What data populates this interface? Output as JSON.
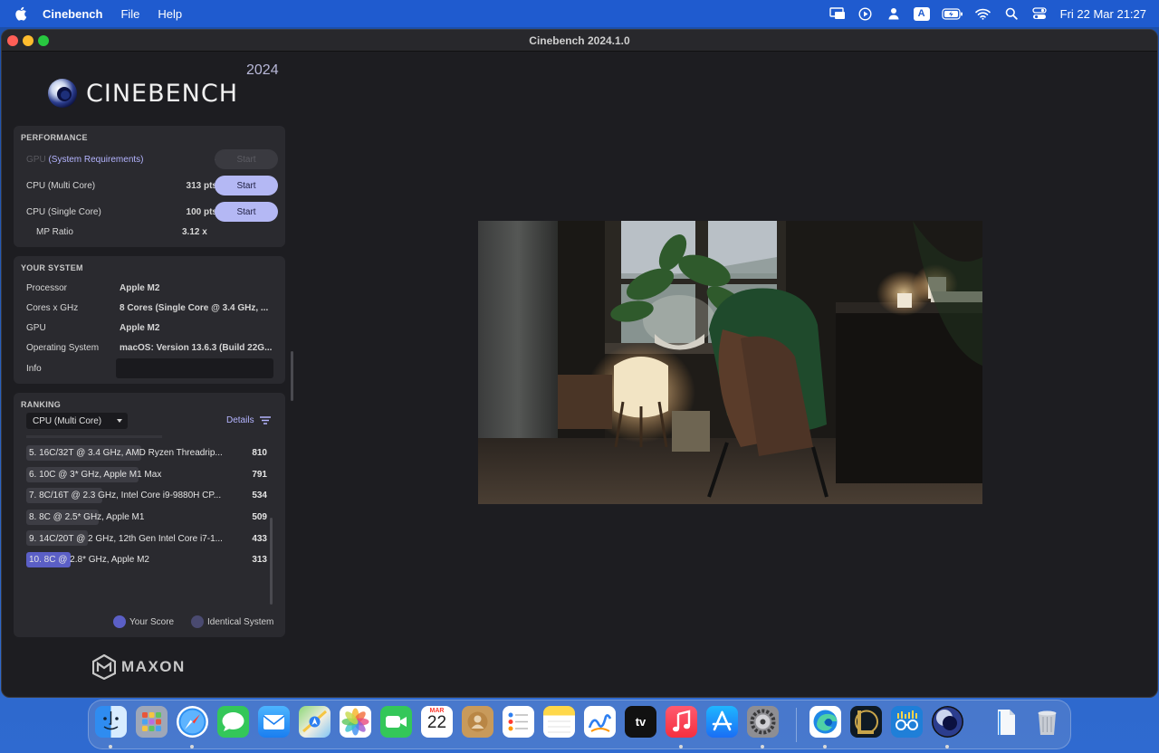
{
  "menubar": {
    "app_name": "Cinebench",
    "menus": [
      "File",
      "Help"
    ],
    "keyboard_badge": "A",
    "clock": "Fri 22 Mar  21:27"
  },
  "window": {
    "title": "Cinebench 2024.1.0"
  },
  "logo": {
    "name": "CINEBENCH",
    "year": "2024"
  },
  "performance": {
    "title": "PERFORMANCE",
    "gpu": {
      "label_prefix": "GPU",
      "label_link": "(System Requirements)",
      "value": "-",
      "button": "Start"
    },
    "cpu_multi": {
      "label": "CPU (Multi Core)",
      "value": "313 pts",
      "button": "Start"
    },
    "cpu_single": {
      "label": "CPU (Single Core)",
      "value": "100 pts",
      "button": "Start"
    },
    "mp_ratio": {
      "label": "MP Ratio",
      "value": "3.12 x"
    }
  },
  "your_system": {
    "title": "YOUR SYSTEM",
    "rows": [
      {
        "key": "Processor",
        "value": "Apple M2"
      },
      {
        "key": "Cores x GHz",
        "value": "8 Cores (Single Core @ 3.4 GHz, ..."
      },
      {
        "key": "GPU",
        "value": "Apple M2"
      },
      {
        "key": "Operating System",
        "value": "macOS: Version 13.6.3 (Build 22G..."
      },
      {
        "key": "Info",
        "value": ""
      }
    ]
  },
  "ranking": {
    "title": "RANKING",
    "selected_test": "CPU (Multi Core)",
    "details_label": "Details",
    "items": [
      {
        "name": "5. 16C/32T @ 3.4 GHz, AMD Ryzen Threadrip...",
        "score": "810",
        "fraction": 0.81,
        "mine": false
      },
      {
        "name": "6. 10C @ 3* GHz, Apple M1 Max",
        "score": "791",
        "fraction": 0.79,
        "mine": false
      },
      {
        "name": "7. 8C/16T @ 2.3 GHz, Intel Core i9-9880H CP...",
        "score": "534",
        "fraction": 0.534,
        "mine": false
      },
      {
        "name": "8. 8C @ 2.5* GHz, Apple M1",
        "score": "509",
        "fraction": 0.509,
        "mine": false
      },
      {
        "name": "9. 14C/20T @ 2 GHz, 12th Gen Intel Core i7-1...",
        "score": "433",
        "fraction": 0.433,
        "mine": false
      },
      {
        "name": "10. 8C @ 2.8* GHz, Apple M2",
        "score": "313",
        "fraction": 0.313,
        "mine": true
      }
    ],
    "legend": {
      "your_score": "Your Score",
      "identical_system": "Identical System"
    },
    "colors": {
      "your_score": "#5b5fc6",
      "identical_system": "#4a4a70"
    }
  },
  "footer": {
    "brand": "MAXON"
  },
  "dock": {
    "apps": [
      "Finder",
      "Launchpad",
      "Safari",
      "Messages",
      "Mail",
      "Maps",
      "Photos",
      "FaceTime",
      "Calendar",
      "Contacts",
      "Reminders",
      "Notes",
      "Freeform",
      "TV",
      "Music",
      "App Store",
      "System Settings",
      "Microsoft Edge",
      "League of Legends",
      "Glasses App",
      "Cinebench",
      "Documents",
      "Trash"
    ],
    "calendar_month": "MAR",
    "calendar_day": "22",
    "tv_label": "tv"
  }
}
